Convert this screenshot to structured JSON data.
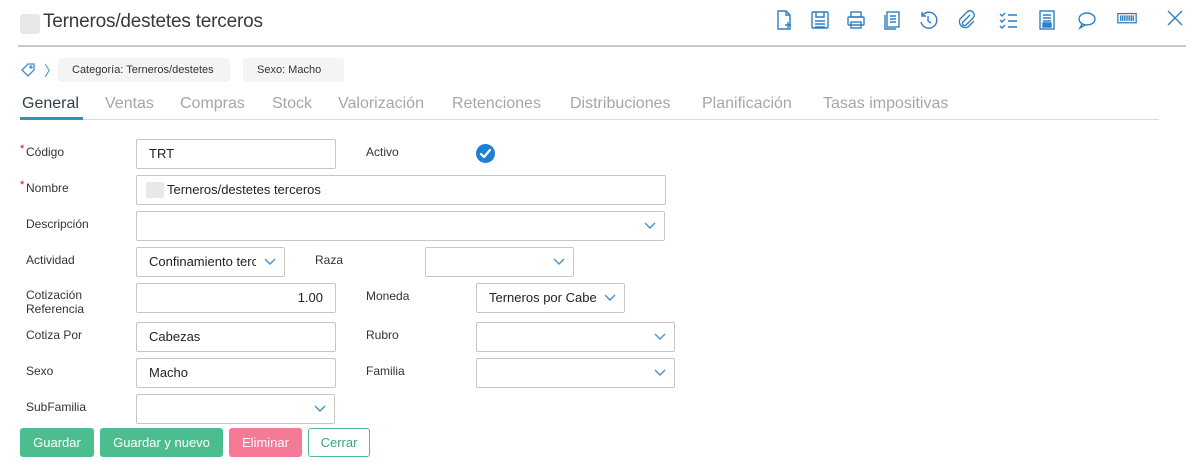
{
  "window": {
    "title": "Terneros/destetes terceros"
  },
  "toolbar": {
    "icons": [
      "new-document-icon",
      "save-icon",
      "print-icon",
      "copy-icon",
      "history-icon",
      "attach-icon",
      "checklist-icon",
      "report-icon",
      "comment-icon",
      "barcode-icon",
      "close-icon"
    ]
  },
  "breadcrumb": {
    "chips": [
      "Categoría: Terneros/destetes",
      "Sexo: Macho"
    ]
  },
  "tabs": [
    {
      "label": "General",
      "active": true
    },
    {
      "label": "Ventas"
    },
    {
      "label": "Compras"
    },
    {
      "label": "Stock"
    },
    {
      "label": "Valorización"
    },
    {
      "label": "Retenciones"
    },
    {
      "label": "Distribuciones"
    },
    {
      "label": "Planificación"
    },
    {
      "label": "Tasas impositivas"
    }
  ],
  "form": {
    "codigo": {
      "label": "Código",
      "value": "TRT"
    },
    "activo": {
      "label": "Activo",
      "checked": true
    },
    "nombre": {
      "label": "Nombre",
      "value": "Terneros/destetes terceros"
    },
    "descripcion": {
      "label": "Descripción",
      "value": ""
    },
    "actividad": {
      "label": "Actividad",
      "value": "Confinamiento terceros"
    },
    "raza": {
      "label": "Raza",
      "value": ""
    },
    "cotizacion": {
      "label_line1": "Cotización",
      "label_line2": "Referencia",
      "value": "1.00"
    },
    "moneda": {
      "label": "Moneda",
      "value": "Terneros por Cabeza"
    },
    "cotiza_por": {
      "label": "Cotiza Por",
      "value": "Cabezas"
    },
    "rubro": {
      "label": "Rubro",
      "value": ""
    },
    "sexo": {
      "label": "Sexo",
      "value": "Macho"
    },
    "familia": {
      "label": "Familia",
      "value": ""
    },
    "subfamilia": {
      "label": "SubFamilia",
      "value": ""
    }
  },
  "buttons": {
    "save": "Guardar",
    "save_new": "Guardar y nuevo",
    "delete": "Eliminar",
    "close": "Cerrar"
  },
  "colors": {
    "accent": "#2795c9",
    "save": "#4cbd8e",
    "delete": "#f47a95",
    "icon": "#2f7fc1",
    "required": "#d0021b"
  }
}
